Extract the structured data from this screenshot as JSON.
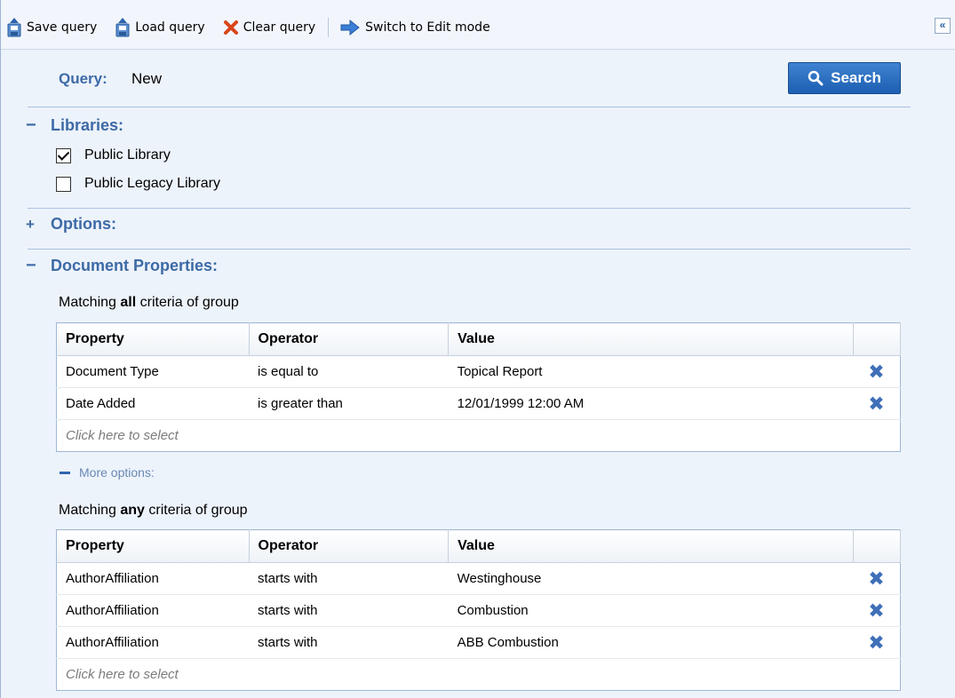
{
  "toolbar": {
    "save_label": "Save query",
    "load_label": "Load query",
    "clear_label": "Clear query",
    "switch_label": "Switch to Edit mode",
    "collapse_symbol": "«"
  },
  "query": {
    "label": "Query:",
    "name": "New",
    "search_label": "Search"
  },
  "libraries": {
    "toggle": "−",
    "title": "Libraries:",
    "items": [
      {
        "label": "Public Library",
        "checked": true
      },
      {
        "label": "Public Legacy Library",
        "checked": false
      }
    ]
  },
  "options": {
    "toggle": "+",
    "title": "Options:"
  },
  "document_properties": {
    "toggle": "−",
    "title": "Document Properties:",
    "group_all": {
      "prefix": "Matching ",
      "keyword": "all",
      "suffix": " criteria of group",
      "columns": [
        "Property",
        "Operator",
        "Value",
        ""
      ],
      "rows": [
        {
          "property": "Document Type",
          "operator": "is equal to",
          "value": "Topical Report"
        },
        {
          "property": "Date Added",
          "operator": "is greater than",
          "value": "12/01/1999 12:00 AM"
        }
      ],
      "select_placeholder": "Click here to select"
    },
    "more_options": "More options:",
    "group_any": {
      "prefix": "Matching ",
      "keyword": "any",
      "suffix": " criteria of group",
      "columns": [
        "Property",
        "Operator",
        "Value",
        ""
      ],
      "rows": [
        {
          "property": "AuthorAffiliation",
          "operator": "starts with",
          "value": "Westinghouse"
        },
        {
          "property": "AuthorAffiliation",
          "operator": "starts with",
          "value": "Combustion"
        },
        {
          "property": "AuthorAffiliation",
          "operator": "starts with",
          "value": "ABB Combustion"
        }
      ],
      "select_placeholder": "Click here to select"
    }
  },
  "icons": {
    "delete": "✖",
    "accent": "#3d6aa6"
  }
}
